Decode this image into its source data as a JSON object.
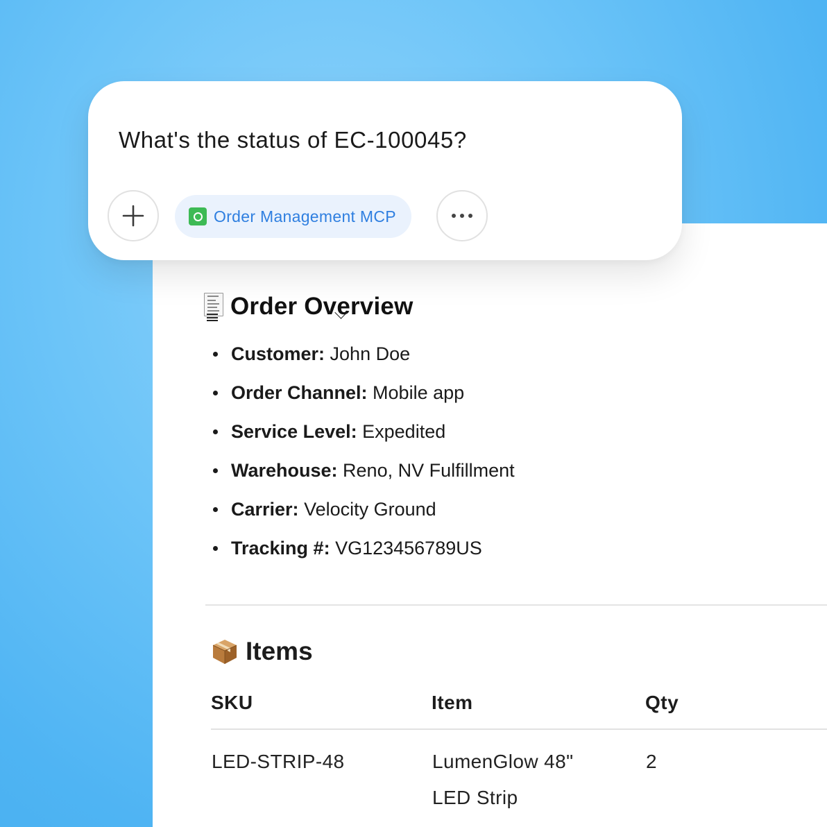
{
  "prompt": {
    "text": "What's the status of EC-100045?",
    "add_icon": "plus-icon",
    "more_icon": "more-horizontal-icon",
    "mcp_chip": {
      "label": "Order Management MCP",
      "icon": "mcp-server-icon",
      "icon_color": "#3dba55",
      "text_color": "#2f7fe0",
      "background": "#eaf2fd"
    }
  },
  "overview": {
    "icon": "receipt-icon",
    "title": "Order Overview",
    "fields": [
      {
        "label": "Customer:",
        "value": "John Doe"
      },
      {
        "label": "Order Channel:",
        "value": "Mobile app"
      },
      {
        "label": "Service Level:",
        "value": "Expedited"
      },
      {
        "label": "Warehouse:",
        "value": "Reno, NV Fulfillment"
      },
      {
        "label": "Carrier:",
        "value": "Velocity Ground"
      },
      {
        "label": "Tracking #:",
        "value": "VG123456789US"
      }
    ]
  },
  "items": {
    "icon": "package-icon",
    "title": "Items",
    "columns": [
      "SKU",
      "Item",
      "Qty"
    ],
    "rows": [
      {
        "sku": "LED-STRIP-48",
        "item": "LumenGlow 48\" LED Strip",
        "qty": "2"
      }
    ]
  },
  "colors": {
    "background": "#4fb4f3",
    "panel": "#ffffff"
  }
}
